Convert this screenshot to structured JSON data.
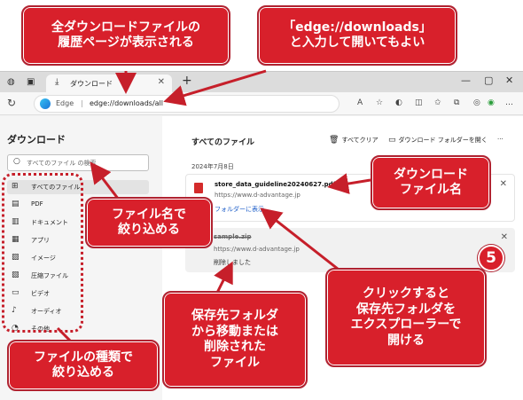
{
  "callouts": {
    "history_page": "全ダウンロードファイルの\n履歴ページが表示される",
    "url_input": "「edge://downloads」\nと入力して開いてもよい",
    "filter_by_name": "ファイル名で\n絞り込める",
    "file_name": "ダウンロード\nファイル名",
    "click_open": "クリックすると\n保存先フォルダを\nエクスプローラーで\n開ける",
    "moved_deleted": "保存先フォルダ\nから移動または\n削除された\nファイル",
    "filter_by_type": "ファイルの種類で\n絞り込める",
    "step_number": "5"
  },
  "browser": {
    "tab_label": "ダウンロード",
    "address_brand": "Edge",
    "address_sep": "|",
    "address_url": "edge://downloads/all"
  },
  "sidebar": {
    "title": "ダウンロード",
    "search_placeholder": "すべてのファイル の検索",
    "items": [
      {
        "icon": "grid-icon",
        "glyph": "⊞",
        "label": "すべてのファイル"
      },
      {
        "icon": "pdf-icon",
        "glyph": "▤",
        "label": "PDF"
      },
      {
        "icon": "document-icon",
        "glyph": "▥",
        "label": "ドキュメント"
      },
      {
        "icon": "apps-icon",
        "glyph": "▦",
        "label": "アプリ"
      },
      {
        "icon": "image-icon",
        "glyph": "▨",
        "label": "イメージ"
      },
      {
        "icon": "archive-icon",
        "glyph": "▧",
        "label": "圧縮ファイル"
      },
      {
        "icon": "video-icon",
        "glyph": "▭",
        "label": "ビデオ"
      },
      {
        "icon": "audio-icon",
        "glyph": "♪",
        "label": "オーディオ"
      },
      {
        "icon": "other-icon",
        "glyph": "◔",
        "label": "その他"
      }
    ]
  },
  "main": {
    "title": "すべてのファイル",
    "clear_all": "すべてクリア",
    "open_folder": "ダウンロード フォルダーを開く",
    "more": "···",
    "date": "2024年7月8日",
    "file1": {
      "name": "store_data_guideline20240627.pdf",
      "site": "https://www.d-advantage.jp",
      "link": "フォルダーに表示"
    },
    "file2": {
      "name": "sample.zip",
      "site": "https://www.d-advantage.jp",
      "status": "削除しました"
    }
  },
  "colors": {
    "callout_red": "#d8202b",
    "link_blue": "#1f5fc9"
  }
}
